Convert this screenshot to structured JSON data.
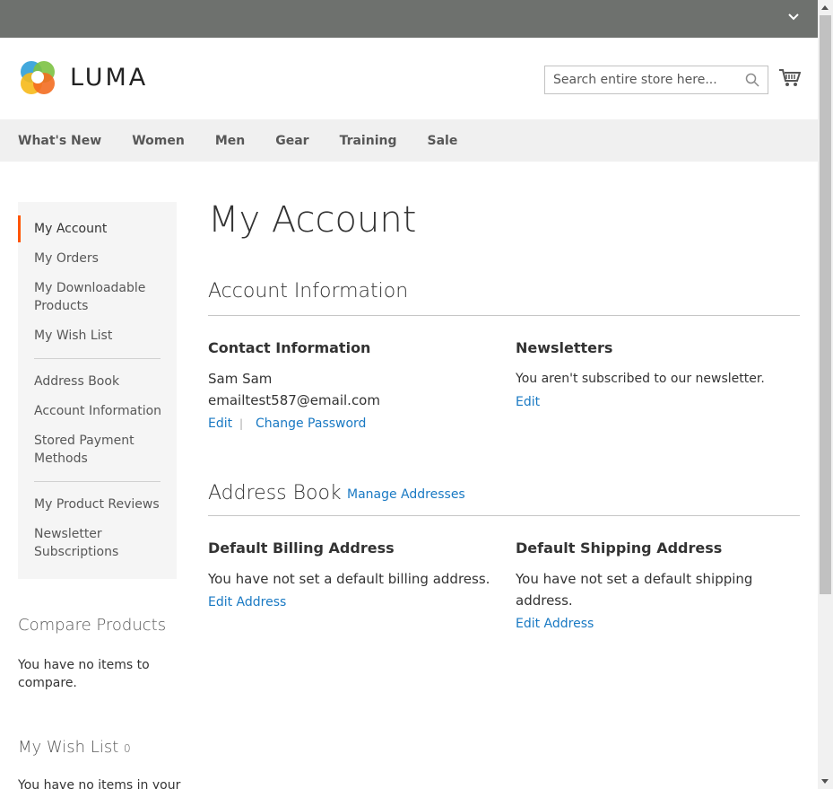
{
  "header": {
    "brand": "LUMA",
    "search_placeholder": "Search entire store here..."
  },
  "nav": {
    "items": [
      "What's New",
      "Women",
      "Men",
      "Gear",
      "Training",
      "Sale"
    ]
  },
  "sidebar": {
    "items": [
      "My Account",
      "My Orders",
      "My Downloadable Products",
      "My Wish List",
      "Address Book",
      "Account Information",
      "Stored Payment Methods",
      "My Product Reviews",
      "Newsletter Subscriptions"
    ],
    "active_color": "#ff5501"
  },
  "compare": {
    "title": "Compare Products",
    "text": "You have no items to compare."
  },
  "wishlist": {
    "title": "My Wish List",
    "count": "0",
    "text": "You have no items in your"
  },
  "main": {
    "page_title": "My Account",
    "account_info": {
      "title": "Account Information",
      "contact_title": "Contact Information",
      "name": "Sam Sam",
      "email": "emailtest587@email.com",
      "edit": "Edit",
      "separator": "|",
      "change_password": "Change Password",
      "newsletters_title": "Newsletters",
      "newsletters_text": "You aren't subscribed to our newsletter.",
      "newsletters_edit": "Edit"
    },
    "address_book": {
      "title": "Address Book",
      "manage": "Manage Addresses",
      "billing_title": "Default Billing Address",
      "billing_text": "You have not set a default billing address.",
      "billing_edit": "Edit Address",
      "shipping_title": "Default Shipping Address",
      "shipping_text": "You have not set a default shipping address.",
      "shipping_edit": "Edit Address"
    }
  },
  "colors": {
    "topbar": "#6e716e",
    "link": "#1979c3",
    "nav_bg": "#f0f0f0"
  }
}
